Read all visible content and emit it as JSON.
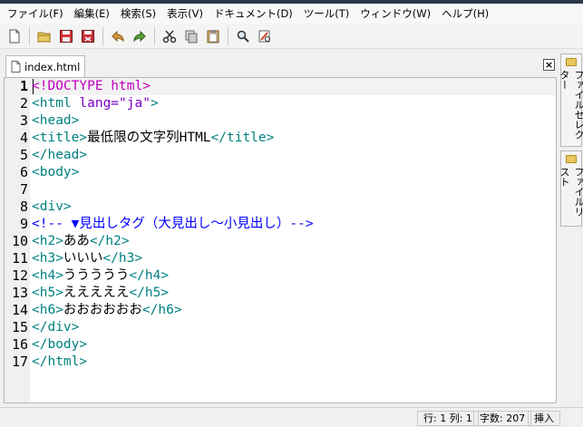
{
  "menu": [
    "ファイル(F)",
    "編集(E)",
    "検索(S)",
    "表示(V)",
    "ドキュメント(D)",
    "ツール(T)",
    "ウィンドウ(W)",
    "ヘルプ(H)"
  ],
  "toolbar_icons": [
    "new-file-icon",
    "open-folder-icon",
    "save-icon",
    "save-all-icon",
    "undo-icon",
    "redo-icon",
    "cut-icon",
    "copy-icon",
    "paste-icon",
    "search-icon",
    "replace-icon"
  ],
  "editor": {
    "tab_label": "index.html",
    "close_label": "×",
    "current_line": 1,
    "lines": [
      {
        "n": "1",
        "segments": [
          [
            "doctype",
            "<!DOCTYPE html>"
          ]
        ]
      },
      {
        "n": "2",
        "segments": [
          [
            "tag",
            "<html "
          ],
          [
            "attr",
            "lang="
          ],
          [
            "val",
            "\"ja\""
          ],
          [
            "tag",
            ">"
          ]
        ]
      },
      {
        "n": "3",
        "segments": [
          [
            "tag",
            "<head>"
          ]
        ]
      },
      {
        "n": "4",
        "segments": [
          [
            "tag",
            "<title>"
          ],
          [
            "text",
            "最低限の文字列HTML"
          ],
          [
            "tag",
            "</title>"
          ]
        ]
      },
      {
        "n": "5",
        "segments": [
          [
            "tag",
            "</head>"
          ]
        ]
      },
      {
        "n": "6",
        "segments": [
          [
            "tag",
            "<body>"
          ]
        ]
      },
      {
        "n": "7",
        "segments": []
      },
      {
        "n": "8",
        "segments": [
          [
            "tag",
            "<div>"
          ]
        ]
      },
      {
        "n": "9",
        "segments": [
          [
            "comment",
            "<!-- ▼見出しタグ（大見出し～小見出し）-->"
          ]
        ]
      },
      {
        "n": "10",
        "segments": [
          [
            "tag",
            "<h2>"
          ],
          [
            "text",
            "ああ"
          ],
          [
            "tag",
            "</h2>"
          ]
        ]
      },
      {
        "n": "11",
        "segments": [
          [
            "tag",
            "<h3>"
          ],
          [
            "text",
            "いいい"
          ],
          [
            "tag",
            "</h3>"
          ]
        ]
      },
      {
        "n": "12",
        "segments": [
          [
            "tag",
            "<h4>"
          ],
          [
            "text",
            "ううううう"
          ],
          [
            "tag",
            "</h4>"
          ]
        ]
      },
      {
        "n": "13",
        "segments": [
          [
            "tag",
            "<h5>"
          ],
          [
            "text",
            "えええええ"
          ],
          [
            "tag",
            "</h5>"
          ]
        ]
      },
      {
        "n": "14",
        "segments": [
          [
            "tag",
            "<h6>"
          ],
          [
            "text",
            "おおおおおお"
          ],
          [
            "tag",
            "</h6>"
          ]
        ]
      },
      {
        "n": "15",
        "segments": [
          [
            "tag",
            "</div>"
          ]
        ]
      },
      {
        "n": "16",
        "segments": [
          [
            "tag",
            "</body>"
          ]
        ]
      },
      {
        "n": "17",
        "segments": [
          [
            "tag",
            "</html>"
          ]
        ]
      }
    ]
  },
  "side_tabs": [
    "ファイルセレクター",
    "ファイルリスト"
  ],
  "status": {
    "position": "行: 1 列: 1",
    "chars": "字数: 207",
    "mode": "挿入"
  }
}
